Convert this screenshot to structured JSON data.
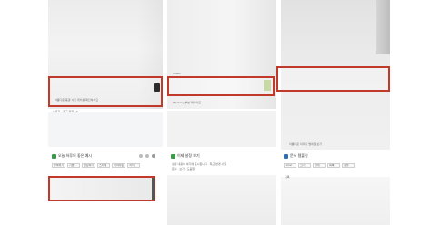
{
  "panels": {
    "top_left": {
      "caption": "아름다운 풍경 사진 위치를 확인하세요",
      "meta": "사용자 · 최근 항목 · 5"
    },
    "top_mid": {
      "caption_top": "Video",
      "caption_bottom": "Tracking 부분 레이아웃"
    },
    "top_right": {
      "footer": "아름다운 이미지 썸네일 보기"
    },
    "bottom_left": {
      "title": "오늘 하루의 좋은 예시",
      "toolbar": [
        "붙여넣기",
        "기본",
        "편집하기",
        "스타일",
        "레이아웃",
        "서식"
      ]
    },
    "bottom_mid": {
      "title": "이제 설정 보기",
      "line1": "설정 내용이 여기에 표시됩니다 · 최근 변경 사항",
      "line2": "문서 · 보기 · 도움말"
    },
    "bottom_right": {
      "title": "문서 템플릿",
      "toolbar": [
        "Arial",
        "크기",
        "굵게",
        "목록",
        "정렬"
      ],
      "sub": "기록"
    }
  },
  "colors": {
    "highlight": "#c0392b",
    "accent_green": "#3c9a4a",
    "accent_blue": "#2f6fb3"
  }
}
